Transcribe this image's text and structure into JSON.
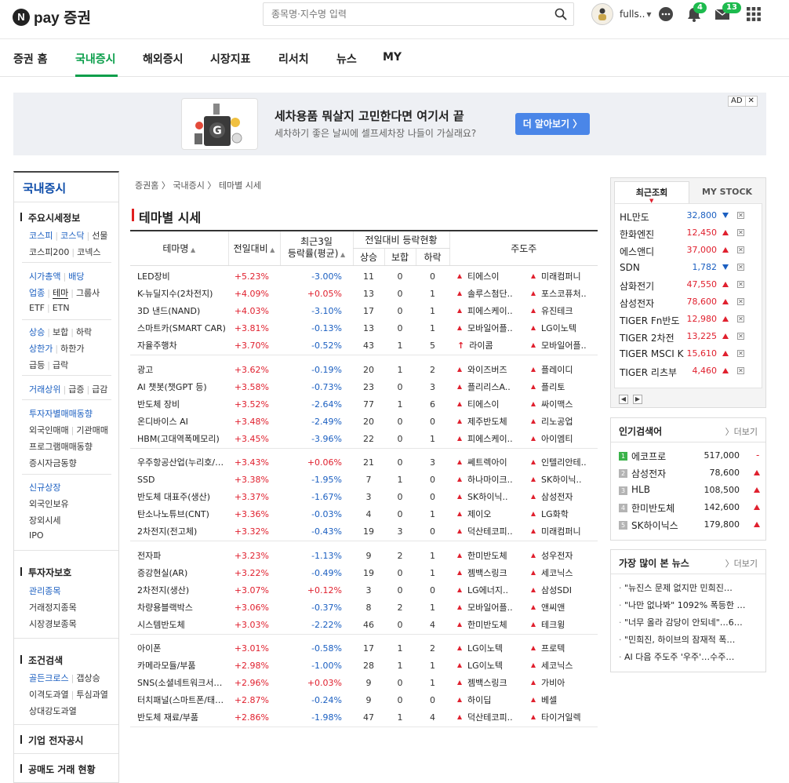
{
  "header": {
    "logo_letter": "N",
    "logo_text": "pay 증권",
    "search_placeholder": "종목명·지수명 입력",
    "username": "fulls..",
    "notify_count": "4",
    "mail_count": "13"
  },
  "gnb": [
    "증권 홈",
    "국내증시",
    "해외증시",
    "시장지표",
    "리서치",
    "뉴스",
    "MY"
  ],
  "ad": {
    "title": "세차용품 뭐살지 고민한다면 여기서 끝",
    "desc": "세차하기 좋은 날씨에 셀프세차장 나들이 가실래요?",
    "button": "더 알아보기 〉",
    "tag": "AD",
    "close": "✕"
  },
  "lnb": {
    "title": "국내증시",
    "s1_title": "주요시세정보",
    "s1": {
      "kospi": "코스피",
      "kosdaq": "코스닥",
      "futures": "선물",
      "kospi200": "코스피200",
      "konex": "코넥스",
      "mcap": "시가총액",
      "dividend": "배당",
      "sector": "업종",
      "theme": "테마",
      "group": "그룹사",
      "etf": "ETF",
      "etn": "ETN",
      "rise": "상승",
      "flat": "보합",
      "fall": "하락",
      "upper": "상한가",
      "lower": "하한가",
      "surge": "급등",
      "plunge": "급락",
      "volume_top": "거래상위",
      "vol_surge": "급증",
      "vol_plunge": "급감",
      "investor": "투자자별매매동향",
      "foreign": "외국인매매",
      "inst": "기관매매",
      "program": "프로그램매매동향",
      "deposit": "증시자금동향",
      "new_listing": "신규상장",
      "foreign_hold": "외국인보유",
      "otc": "장외시세",
      "ipo": "IPO"
    },
    "s2_title": "투자자보호",
    "s2": {
      "managed": "관리종목",
      "halted": "거래정지종목",
      "warning": "시장경보종목"
    },
    "s3_title": "조건검색",
    "s3": {
      "golden": "골든크로스",
      "gap": "갭상승",
      "disparity": "이격도과열",
      "psych": "투심과열",
      "rsi": "상대강도과열"
    },
    "s4_title": "기업 전자공시",
    "s5_title": "공매도 거래 현황"
  },
  "main": {
    "crumb": [
      "증권홈",
      "국내증시",
      "테마별 시세"
    ],
    "title": "테마별 시세",
    "headers": {
      "name": "테마명",
      "change": "전일대비",
      "avg3_line1": "최근3일",
      "avg3_line2": "등락률(평균)",
      "status": "전일대비 등락현황",
      "up": "상승",
      "flat": "보합",
      "down": "하락",
      "leaders": "주도주"
    },
    "groups": [
      [
        {
          "name": "LED장비",
          "chg": "+5.23%",
          "avg": "-3.00%",
          "up": "11",
          "flat": "0",
          "down": "0",
          "l1": "티에스이",
          "l2": "미래컴퍼니",
          "s1": "tri",
          "s2": "tri"
        },
        {
          "name": "K-뉴딜지수(2차전지)",
          "chg": "+4.09%",
          "avg": "+0.05%",
          "up": "13",
          "flat": "0",
          "down": "1",
          "l1": "솔루스첨단..",
          "l2": "포스코퓨처..",
          "s1": "tri",
          "s2": "tri"
        },
        {
          "name": "3D 낸드(NAND)",
          "chg": "+4.03%",
          "avg": "-3.10%",
          "up": "17",
          "flat": "0",
          "down": "1",
          "l1": "피에스케이..",
          "l2": "유진테크",
          "s1": "tri",
          "s2": "tri"
        },
        {
          "name": "스마트카(SMART CAR)",
          "chg": "+3.81%",
          "avg": "-0.13%",
          "up": "13",
          "flat": "0",
          "down": "1",
          "l1": "모바일어플..",
          "l2": "LG이노텍",
          "s1": "tri",
          "s2": "tri"
        },
        {
          "name": "자율주행차",
          "chg": "+3.70%",
          "avg": "-0.52%",
          "up": "43",
          "flat": "1",
          "down": "5",
          "l1": "라이콤",
          "l2": "모바일어플..",
          "s1": "sky",
          "s2": "tri"
        }
      ],
      [
        {
          "name": "광고",
          "chg": "+3.62%",
          "avg": "-0.19%",
          "up": "20",
          "flat": "1",
          "down": "2",
          "l1": "와이즈버즈",
          "l2": "플레이디",
          "s1": "tri",
          "s2": "tri"
        },
        {
          "name": "AI 챗봇(챗GPT 등)",
          "chg": "+3.58%",
          "avg": "-0.73%",
          "up": "23",
          "flat": "0",
          "down": "3",
          "l1": "플리리스A..",
          "l2": "플리토",
          "s1": "tri",
          "s2": "tri"
        },
        {
          "name": "반도체 장비",
          "chg": "+3.52%",
          "avg": "-2.64%",
          "up": "77",
          "flat": "1",
          "down": "6",
          "l1": "티에스이",
          "l2": "싸이맥스",
          "s1": "tri",
          "s2": "tri"
        },
        {
          "name": "온디바이스 AI",
          "chg": "+3.48%",
          "avg": "-2.49%",
          "up": "20",
          "flat": "0",
          "down": "0",
          "l1": "제주반도체",
          "l2": "리노공업",
          "s1": "tri",
          "s2": "tri"
        },
        {
          "name": "HBM(고대역폭메모리)",
          "chg": "+3.45%",
          "avg": "-3.96%",
          "up": "22",
          "flat": "0",
          "down": "1",
          "l1": "피에스케이..",
          "l2": "아이엠티",
          "s1": "tri",
          "s2": "tri"
        }
      ],
      [
        {
          "name": "우주항공산업(누리호/…",
          "chg": "+3.43%",
          "avg": "+0.06%",
          "up": "21",
          "flat": "0",
          "down": "3",
          "l1": "쎄트렉아이",
          "l2": "인텔리안테..",
          "s1": "tri",
          "s2": "tri"
        },
        {
          "name": "SSD",
          "chg": "+3.38%",
          "avg": "-1.95%",
          "up": "7",
          "flat": "1",
          "down": "0",
          "l1": "하나마이크..",
          "l2": "SK하이닉..",
          "s1": "tri",
          "s2": "tri"
        },
        {
          "name": "반도체 대표주(생산)",
          "chg": "+3.37%",
          "avg": "-1.67%",
          "up": "3",
          "flat": "0",
          "down": "0",
          "l1": "SK하이닉..",
          "l2": "삼성전자",
          "s1": "tri",
          "s2": "tri"
        },
        {
          "name": "탄소나노튜브(CNT)",
          "chg": "+3.36%",
          "avg": "-0.03%",
          "up": "4",
          "flat": "0",
          "down": "1",
          "l1": "제이오",
          "l2": "LG화학",
          "s1": "tri",
          "s2": "tri"
        },
        {
          "name": "2차전지(전고체)",
          "chg": "+3.32%",
          "avg": "-0.43%",
          "up": "19",
          "flat": "3",
          "down": "0",
          "l1": "덕산테코피..",
          "l2": "미래컴퍼니",
          "s1": "tri",
          "s2": "tri"
        }
      ],
      [
        {
          "name": "전자파",
          "chg": "+3.23%",
          "avg": "-1.13%",
          "up": "9",
          "flat": "2",
          "down": "1",
          "l1": "한미반도체",
          "l2": "성우전자",
          "s1": "tri",
          "s2": "tri"
        },
        {
          "name": "증강현실(AR)",
          "chg": "+3.22%",
          "avg": "-0.49%",
          "up": "19",
          "flat": "0",
          "down": "1",
          "l1": "젬백스링크",
          "l2": "세코닉스",
          "s1": "tri",
          "s2": "tri"
        },
        {
          "name": "2차전지(생산)",
          "chg": "+3.07%",
          "avg": "+0.12%",
          "up": "3",
          "flat": "0",
          "down": "0",
          "l1": "LG에너지..",
          "l2": "삼성SDI",
          "s1": "tri",
          "s2": "tri"
        },
        {
          "name": "차량용블랙박스",
          "chg": "+3.06%",
          "avg": "-0.37%",
          "up": "8",
          "flat": "2",
          "down": "1",
          "l1": "모바일어플..",
          "l2": "앤씨앤",
          "s1": "tri",
          "s2": "tri"
        },
        {
          "name": "시스템반도체",
          "chg": "+3.03%",
          "avg": "-2.22%",
          "up": "46",
          "flat": "0",
          "down": "4",
          "l1": "한미반도체",
          "l2": "테크윙",
          "s1": "tri",
          "s2": "tri"
        }
      ],
      [
        {
          "name": "아이폰",
          "chg": "+3.01%",
          "avg": "-0.58%",
          "up": "17",
          "flat": "1",
          "down": "2",
          "l1": "LG이노텍",
          "l2": "프로텍",
          "s1": "tri",
          "s2": "tri"
        },
        {
          "name": "카메라모듈/부품",
          "chg": "+2.98%",
          "avg": "-1.00%",
          "up": "28",
          "flat": "1",
          "down": "1",
          "l1": "LG이노텍",
          "l2": "세코닉스",
          "s1": "tri",
          "s2": "tri"
        },
        {
          "name": "SNS(소셜네트워크서…",
          "chg": "+2.96%",
          "avg": "+0.03%",
          "up": "9",
          "flat": "0",
          "down": "1",
          "l1": "젬백스링크",
          "l2": "가비아",
          "s1": "tri",
          "s2": "tri"
        },
        {
          "name": "터치패널(스마트폰/태…",
          "chg": "+2.87%",
          "avg": "-0.24%",
          "up": "9",
          "flat": "0",
          "down": "0",
          "l1": "하이딥",
          "l2": "베셀",
          "s1": "tri",
          "s2": "tri"
        },
        {
          "name": "반도체 재료/부품",
          "chg": "+2.86%",
          "avg": "-1.98%",
          "up": "47",
          "flat": "1",
          "down": "4",
          "l1": "덕산테코피..",
          "l2": "타이거일렉",
          "s1": "tri",
          "s2": "tri"
        }
      ]
    ]
  },
  "recent": {
    "tab_on": "최근조회",
    "tab_off": "MY STOCK",
    "items": [
      {
        "name": "HL만도",
        "price": "32,800",
        "dir": "down"
      },
      {
        "name": "한화엔진",
        "price": "12,450",
        "dir": "up"
      },
      {
        "name": "에스앤디",
        "price": "37,000",
        "dir": "up"
      },
      {
        "name": "SDN",
        "price": "1,782",
        "dir": "down"
      },
      {
        "name": "삼화전기",
        "price": "47,550",
        "dir": "up"
      },
      {
        "name": "삼성전자",
        "price": "78,600",
        "dir": "up"
      },
      {
        "name": "TIGER Fn반도",
        "price": "12,980",
        "dir": "up"
      },
      {
        "name": "TIGER 2차전",
        "price": "13,225",
        "dir": "up"
      },
      {
        "name": "TIGER MSCI K",
        "price": "15,610",
        "dir": "up"
      },
      {
        "name": "TIGER 리츠부",
        "price": "4,460",
        "dir": "up"
      }
    ]
  },
  "popular": {
    "title": "인기검색어",
    "more": "더보기",
    "items": [
      {
        "rank": "1",
        "name": "에코프로",
        "price": "517,000",
        "dir": "flat",
        "mark": "-"
      },
      {
        "rank": "2",
        "name": "삼성전자",
        "price": "78,600",
        "dir": "up",
        "mark": ""
      },
      {
        "rank": "3",
        "name": "HLB",
        "price": "108,500",
        "dir": "up",
        "mark": ""
      },
      {
        "rank": "4",
        "name": "한미반도체",
        "price": "142,600",
        "dir": "up",
        "mark": ""
      },
      {
        "rank": "5",
        "name": "SK하이닉스",
        "price": "179,800",
        "dir": "up",
        "mark": ""
      }
    ]
  },
  "news": {
    "title": "가장 많이 본 뉴스",
    "more": "더보기",
    "items": [
      "\"뉴진스 문제 없지만 민희진…",
      "\"나만 없나봐\" 1092% 폭등한 …",
      "\"너무 올라 감당이 안되네\"…6…",
      "\"민희진, 하이브의 잠재적 폭…",
      "AI 다음 주도주 '우주'…수주…"
    ]
  },
  "colors": {
    "brand": "#0a9e4a",
    "up": "#e0202e",
    "down": "#1b5fc1",
    "badge": "#1dbb4e",
    "ad_button": "#4a86e8"
  }
}
